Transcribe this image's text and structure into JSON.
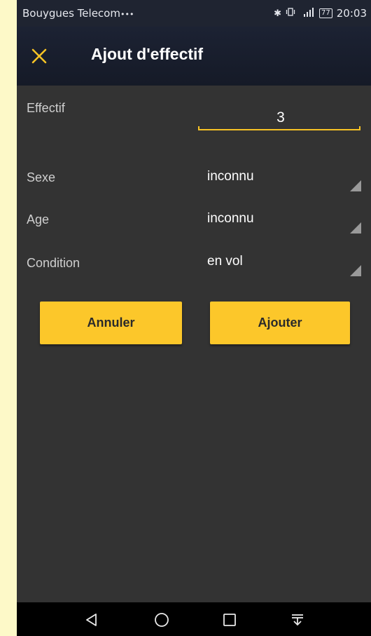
{
  "status_bar": {
    "carrier": "Bouygues Telecom",
    "carrier_dots": "•••",
    "icons": [
      "bluetooth-icon",
      "vibrate-icon",
      "signal-icon"
    ],
    "battery": "77",
    "time": "20:03"
  },
  "app_bar": {
    "close_icon": "close-icon",
    "title": "Ajout d'effectif"
  },
  "form": {
    "effectif": {
      "label": "Effectif",
      "value": "3"
    },
    "sexe": {
      "label": "Sexe",
      "value": "inconnu"
    },
    "age": {
      "label": "Age",
      "value": "inconnu"
    },
    "condition": {
      "label": "Condition",
      "value": "en vol"
    }
  },
  "buttons": {
    "cancel": "Annuler",
    "add": "Ajouter"
  },
  "nav_bar": {
    "icons": [
      "back-icon",
      "home-icon",
      "recents-icon",
      "notifications-pull-icon"
    ]
  },
  "colors": {
    "accent": "#fcc72a",
    "background": "#333333",
    "app_bar": "#1c2233",
    "page_margin": "#fdf9c8"
  }
}
